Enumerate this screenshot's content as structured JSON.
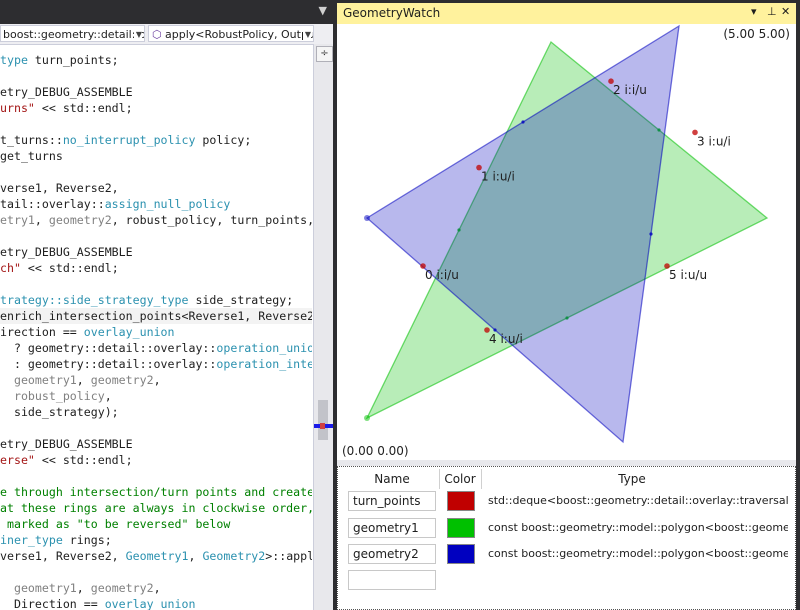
{
  "editor": {
    "nav": {
      "scope": "boost::geometry::detail::ove",
      "member": "apply<RobustPolicy, Outpu"
    },
    "split_glyph": "÷",
    "lines": [
      [
        [
          "t",
          "type"
        ],
        [
          "p",
          " turn_points;"
        ]
      ],
      [
        [
          "p",
          ""
        ]
      ],
      [
        [
          "p",
          "etry_DEBUG_ASSEMBLE"
        ]
      ],
      [
        [
          "s",
          "urns\""
        ],
        [
          "p",
          " << std::endl;"
        ]
      ],
      [
        [
          "p",
          ""
        ]
      ],
      [
        [
          "p",
          "t_turns::"
        ],
        [
          "t",
          "no_interrupt_policy"
        ],
        [
          "p",
          " policy;"
        ]
      ],
      [
        [
          "p",
          "get_turns"
        ]
      ],
      [
        [
          "p",
          ""
        ]
      ],
      [
        [
          "p",
          "verse1, Reverse2,"
        ]
      ],
      [
        [
          "p",
          "tail::overlay::"
        ],
        [
          "t",
          "assign_null_policy"
        ]
      ],
      [
        [
          "g",
          "etry1"
        ],
        [
          "p",
          ", "
        ],
        [
          "g",
          "geometry2"
        ],
        [
          "p",
          ", robust_policy, turn_points,"
        ]
      ],
      [
        [
          "p",
          ""
        ]
      ],
      [
        [
          "p",
          "etry_DEBUG_ASSEMBLE"
        ]
      ],
      [
        [
          "s",
          "ch\""
        ],
        [
          "p",
          " << std::endl;"
        ]
      ],
      [
        [
          "p",
          ""
        ]
      ],
      [
        [
          "t",
          "trategy::side_strategy_type"
        ],
        [
          "p",
          " side_strategy;"
        ]
      ],
      [
        [
          "p",
          "enrich_intersection_points<Reverse1, Reverse2>"
        ]
      ],
      [
        [
          "p",
          "irection == "
        ],
        [
          "t",
          "overlay_union"
        ]
      ],
      [
        [
          "p",
          "  ? geometry::detail::overlay::"
        ],
        [
          "t",
          "operation_union"
        ]
      ],
      [
        [
          "p",
          "  : geometry::detail::overlay::"
        ],
        [
          "t",
          "operation_inter"
        ]
      ],
      [
        [
          "p",
          "  "
        ],
        [
          "g",
          "geometry1"
        ],
        [
          "p",
          ", "
        ],
        [
          "g",
          "geometry2"
        ],
        [
          "p",
          ","
        ]
      ],
      [
        [
          "p",
          "  "
        ],
        [
          "g",
          "robust_policy"
        ],
        [
          "p",
          ","
        ]
      ],
      [
        [
          "p",
          "  side_strategy);"
        ]
      ],
      [
        [
          "p",
          ""
        ]
      ],
      [
        [
          "p",
          "etry_DEBUG_ASSEMBLE"
        ]
      ],
      [
        [
          "s",
          "erse\""
        ],
        [
          "p",
          " << std::endl;"
        ]
      ],
      [
        [
          "p",
          ""
        ]
      ],
      [
        [
          "c",
          "e through intersection/turn points and create"
        ]
      ],
      [
        [
          "c",
          "at these rings are always in clockwise order,"
        ]
      ],
      [
        [
          "c",
          " marked as \"to be reversed\" below"
        ]
      ],
      [
        [
          "t",
          "iner_type"
        ],
        [
          "p",
          " rings;"
        ]
      ],
      [
        [
          "p",
          "verse1, Reverse2, "
        ],
        [
          "t",
          "Geometry1"
        ],
        [
          "p",
          ", "
        ],
        [
          "t",
          "Geometry2"
        ],
        [
          "p",
          ">::appl"
        ]
      ],
      [
        [
          "p",
          ""
        ]
      ],
      [
        [
          "p",
          "  "
        ],
        [
          "g",
          "geometry1"
        ],
        [
          "p",
          ", "
        ],
        [
          "g",
          "geometry2"
        ],
        [
          "p",
          ","
        ]
      ],
      [
        [
          "p",
          "  Direction == "
        ],
        [
          "t",
          "overlay_union"
        ]
      ]
    ],
    "highlight_line": 16
  },
  "geometry_watch": {
    "title": "GeometryWatch",
    "controls": {
      "dropdown": "▾",
      "pin": "⊥",
      "close": "✕"
    },
    "max_coord": "(5.00 5.00)",
    "min_coord": "(0.00 0.00)",
    "extent": [
      0,
      5
    ],
    "colors": {
      "turn_points": "#c00000",
      "geometry1": "#00c000",
      "geometry2": "#0000c0"
    },
    "geometry1": [
      [
        0.0,
        0.3
      ],
      [
        2.3,
        5.0
      ],
      [
        5.0,
        2.8
      ]
    ],
    "geometry2": [
      [
        0.0,
        2.8
      ],
      [
        3.9,
        5.2
      ],
      [
        3.2,
        0.0
      ]
    ],
    "turn_points": [
      {
        "label": "0 i:i/u",
        "x": 0.7,
        "y": 2.2
      },
      {
        "label": "1 i:u/i",
        "x": 1.4,
        "y": 3.43
      },
      {
        "label": "2 i:i/u",
        "x": 3.05,
        "y": 4.51
      },
      {
        "label": "3 i:u/i",
        "x": 4.1,
        "y": 3.87
      },
      {
        "label": "4 i:u/i",
        "x": 1.5,
        "y": 1.4
      },
      {
        "label": "5 i:u/u",
        "x": 3.75,
        "y": 2.2
      }
    ],
    "table": {
      "headers": {
        "name": "Name",
        "color": "Color",
        "type": "Type"
      },
      "rows": [
        {
          "name": "turn_points",
          "color": "#c00000",
          "type": "std::deque<boost::geometry::detail::overlay::traversal_tu"
        },
        {
          "name": "geometry1",
          "color": "#00c000",
          "type": "const boost::geometry::model::polygon<boost::geomet"
        },
        {
          "name": "geometry2",
          "color": "#0000c0",
          "type": "const boost::geometry::model::polygon<boost::geomet"
        }
      ]
    }
  }
}
